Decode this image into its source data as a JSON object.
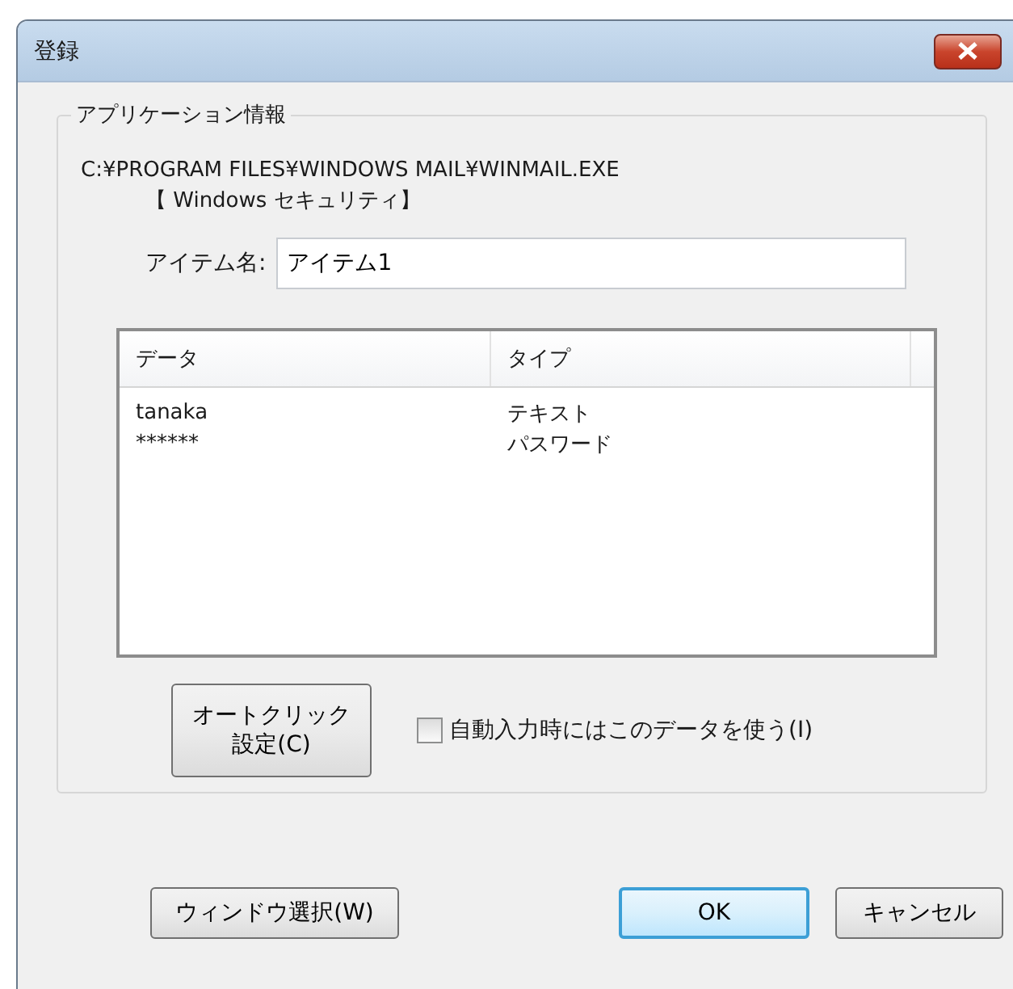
{
  "window": {
    "title": "登録"
  },
  "group": {
    "legend": "アプリケーション情報",
    "path": "C:¥PROGRAM FILES¥WINDOWS MAIL¥WINMAIL.EXE",
    "app_name": "【 Windows セキュリティ】",
    "item_name": {
      "label": "アイテム名:",
      "value": "アイテム1"
    },
    "table": {
      "columns": [
        "データ",
        "タイプ"
      ],
      "rows": [
        [
          "tanaka",
          "テキスト"
        ],
        [
          "******",
          "パスワード"
        ]
      ]
    },
    "auto_click_button": {
      "lines": [
        "オートクリック",
        "設定(C)"
      ]
    },
    "auto_fill_checkbox": {
      "label": "自動入力時にはこのデータを使う(I)",
      "checked": false
    }
  },
  "buttons": [
    {
      "label": "ウィンドウ選択(W)",
      "default": false
    },
    {
      "label": "OK",
      "default": true
    },
    {
      "label": "キャンセル",
      "default": false
    }
  ]
}
